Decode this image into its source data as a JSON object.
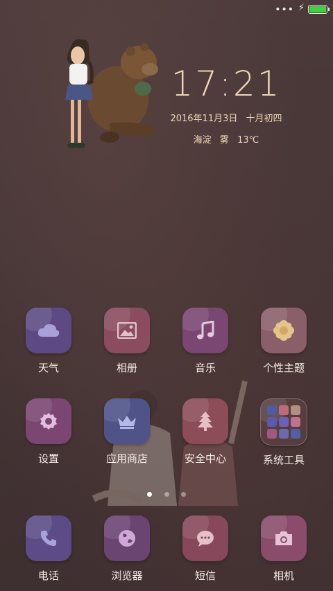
{
  "status_bar": {
    "signal_dots": "•••",
    "charging_icon": "charging-bolt-icon",
    "battery_level": 1.0,
    "battery_color": "#3fd23f"
  },
  "clock_widget": {
    "time": "17:21",
    "date": "2016年11月3日",
    "lunar_date": "十月初四",
    "location": "海淀",
    "weather": "雾",
    "temperature": "13℃"
  },
  "apps": {
    "row1": [
      {
        "label": "天气",
        "icon": "weather-cloud-icon",
        "color": "#5d4a84"
      },
      {
        "label": "相册",
        "icon": "gallery-picture-icon",
        "color": "#8a4c5e"
      },
      {
        "label": "音乐",
        "icon": "music-note-icon",
        "color": "#7a4672"
      },
      {
        "label": "个性主题",
        "icon": "theme-flower-icon",
        "color": "#8a5f6a"
      }
    ],
    "row2": [
      {
        "label": "设置",
        "icon": "settings-gear-icon",
        "color": "#7c4672"
      },
      {
        "label": "应用商店",
        "icon": "app-store-crown-icon",
        "color": "#4f5388"
      },
      {
        "label": "安全中心",
        "icon": "security-tree-icon",
        "color": "#8c4c58"
      },
      {
        "label": "系统工具",
        "icon": "folder-icon",
        "color": "#5a4040"
      }
    ],
    "dock": [
      {
        "label": "电话",
        "icon": "phone-icon",
        "color": "#5c4b86"
      },
      {
        "label": "浏览器",
        "icon": "browser-globe-icon",
        "color": "#6a4572"
      },
      {
        "label": "短信",
        "icon": "message-bubble-icon",
        "color": "#86485a"
      },
      {
        "label": "相机",
        "icon": "camera-icon",
        "color": "#8a4c6a"
      }
    ]
  },
  "page_indicator": {
    "total": 3,
    "active_index": 0
  }
}
